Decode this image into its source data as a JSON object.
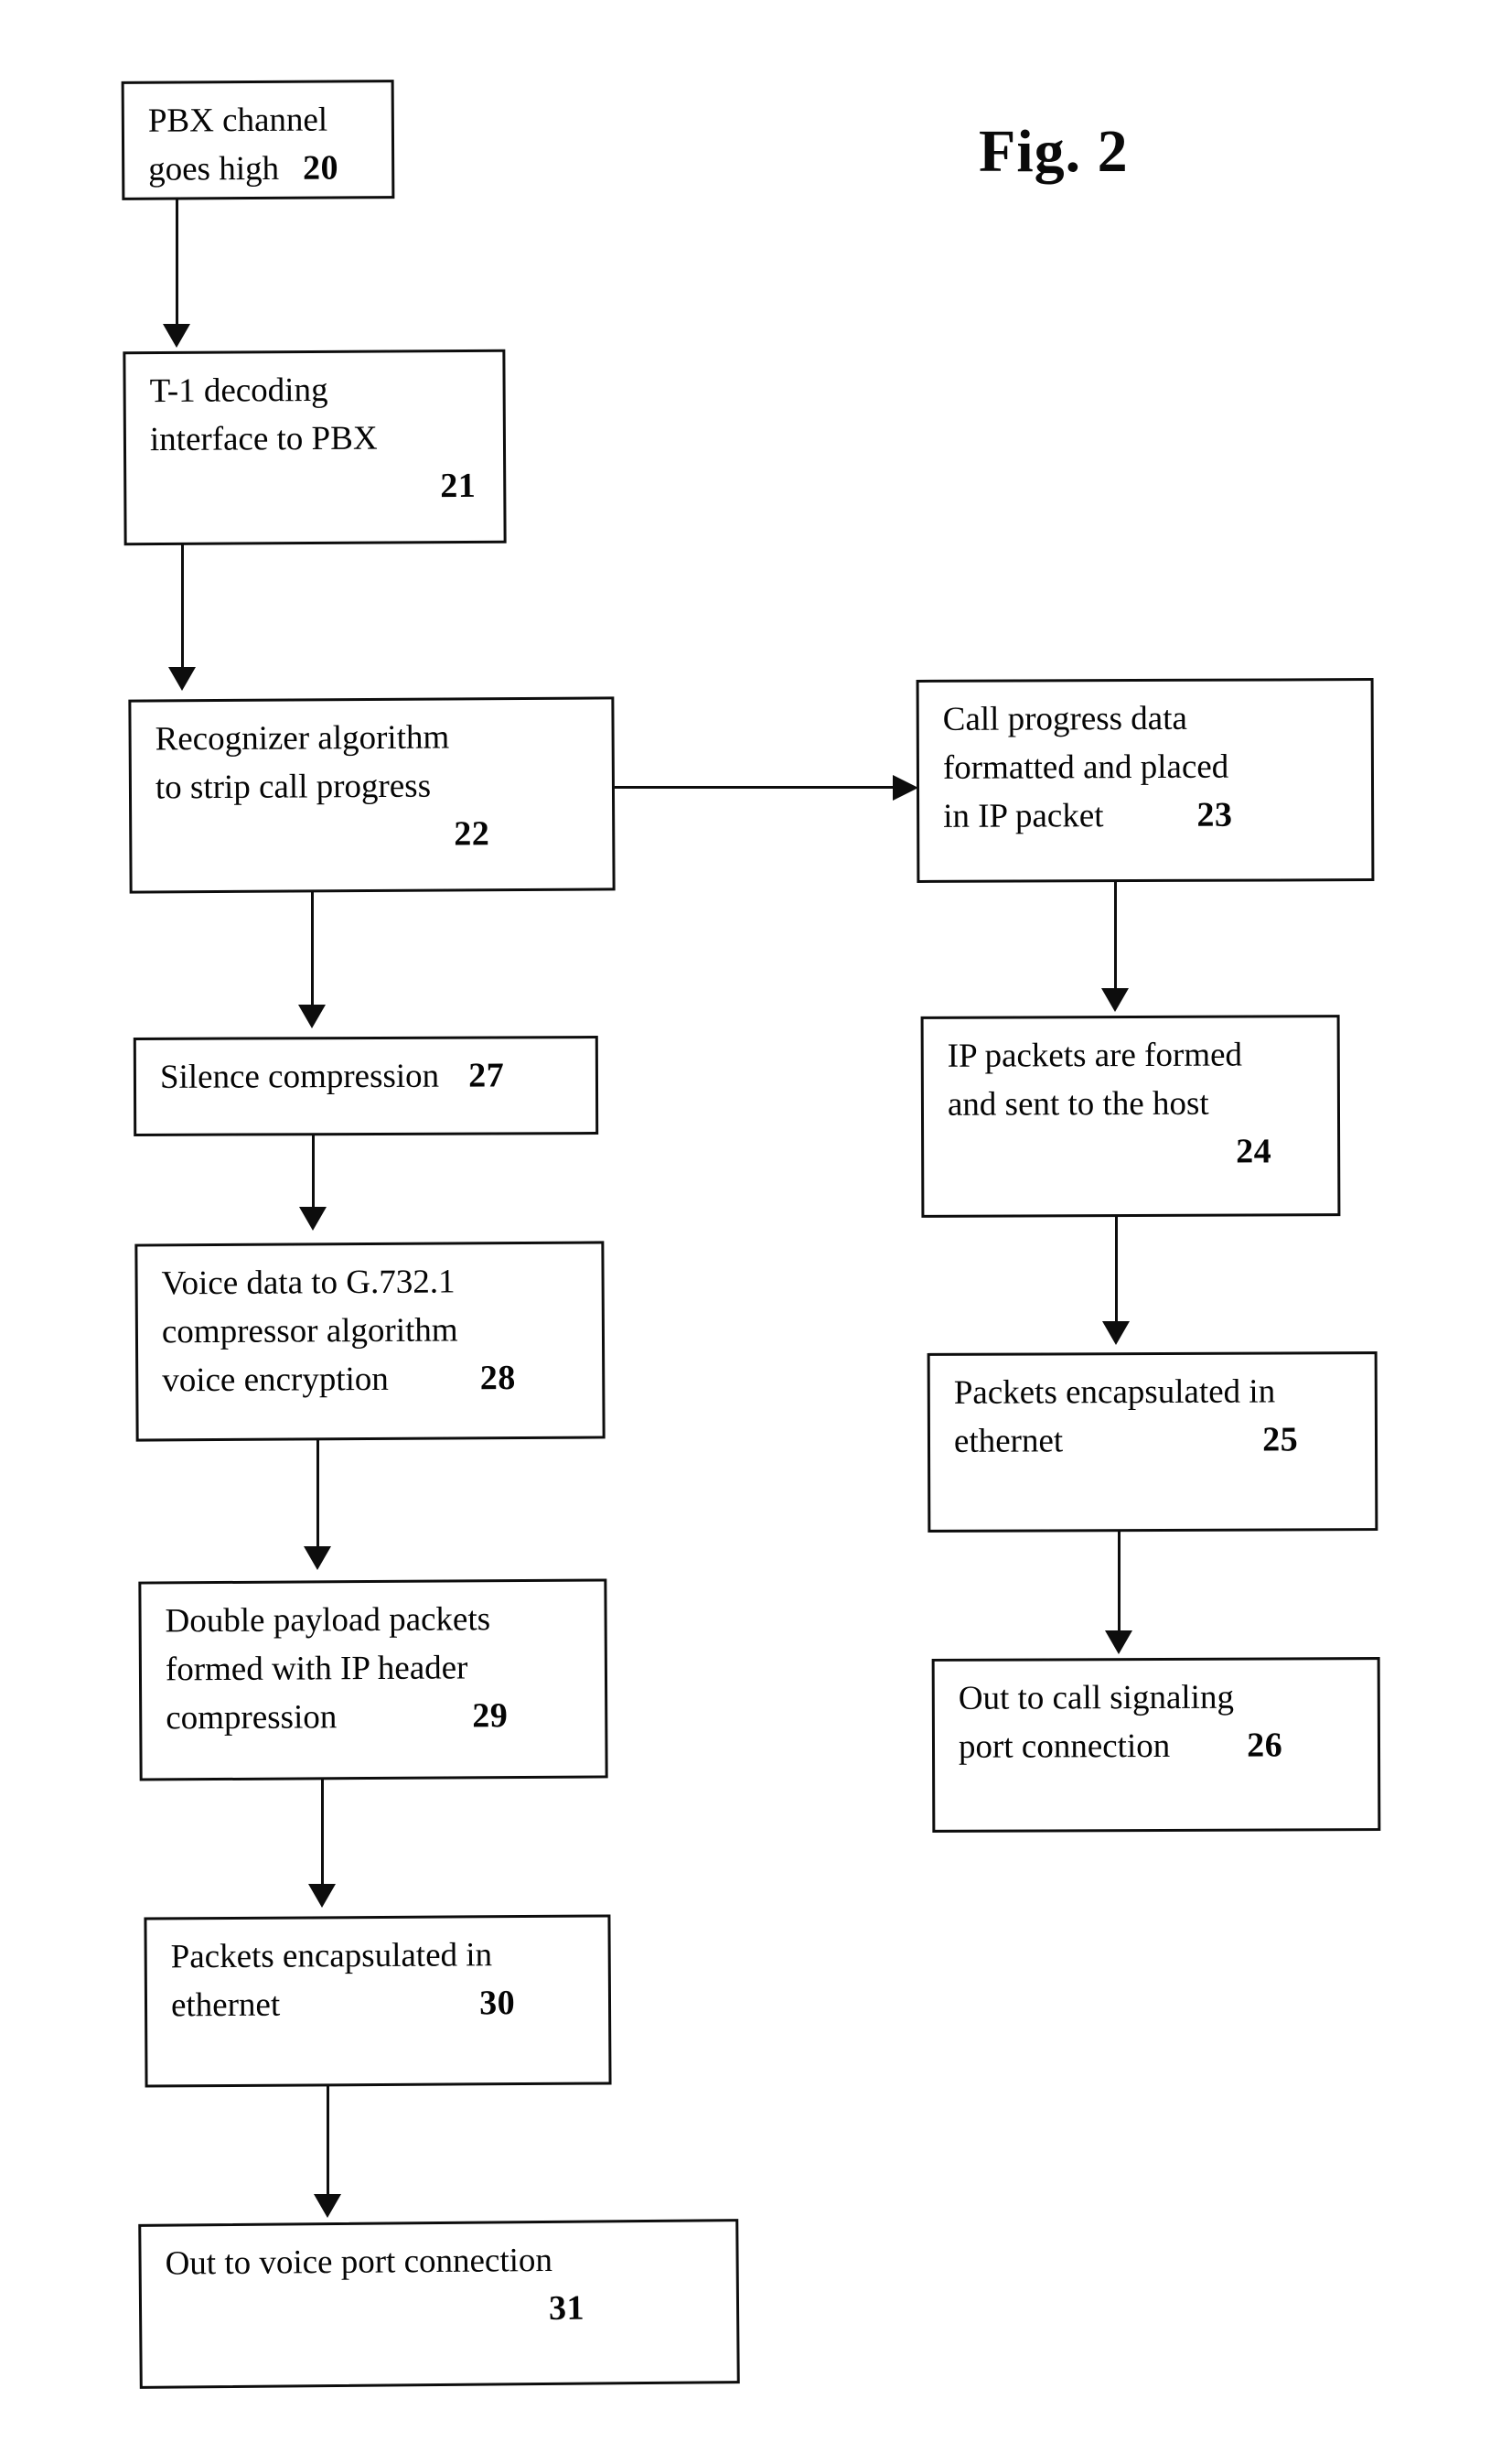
{
  "figure": {
    "title": "Fig. 2",
    "kind": "patent-flowchart"
  },
  "nodes": {
    "n20": {
      "ref": "20",
      "lines": [
        "PBX channel",
        "goes high"
      ]
    },
    "n21": {
      "ref": "21",
      "lines": [
        "T-1 decoding",
        "interface to PBX"
      ]
    },
    "n22": {
      "ref": "22",
      "lines": [
        "Recognizer algorithm",
        "to strip call progress"
      ]
    },
    "n23": {
      "ref": "23",
      "lines": [
        "Call progress data",
        "formatted and placed",
        "in IP packet"
      ]
    },
    "n24": {
      "ref": "24",
      "lines": [
        "IP packets are formed",
        "and sent to the host"
      ]
    },
    "n25": {
      "ref": "25",
      "lines": [
        "Packets encapsulated in",
        "ethernet"
      ]
    },
    "n26": {
      "ref": "26",
      "lines": [
        "Out to call signaling",
        "port connection"
      ]
    },
    "n27": {
      "ref": "27",
      "lines": [
        "Silence compression"
      ]
    },
    "n28": {
      "ref": "28",
      "lines": [
        "Voice data to G.732.1",
        "compressor algorithm",
        "voice encryption"
      ]
    },
    "n29": {
      "ref": "29",
      "lines": [
        "Double payload packets",
        "formed with IP header",
        "compression"
      ]
    },
    "n30": {
      "ref": "30",
      "lines": [
        "Packets encapsulated in",
        "ethernet"
      ]
    },
    "n31": {
      "ref": "31",
      "lines": [
        "Out to voice port connection"
      ]
    }
  },
  "flow": {
    "edges": [
      {
        "from": "20",
        "to": "21",
        "direction": "down"
      },
      {
        "from": "21",
        "to": "22",
        "direction": "down"
      },
      {
        "from": "22",
        "to": "23",
        "direction": "right"
      },
      {
        "from": "22",
        "to": "27",
        "direction": "down"
      },
      {
        "from": "23",
        "to": "24",
        "direction": "down"
      },
      {
        "from": "24",
        "to": "25",
        "direction": "down"
      },
      {
        "from": "25",
        "to": "26",
        "direction": "down"
      },
      {
        "from": "27",
        "to": "28",
        "direction": "down"
      },
      {
        "from": "28",
        "to": "29",
        "direction": "down"
      },
      {
        "from": "29",
        "to": "30",
        "direction": "down"
      },
      {
        "from": "30",
        "to": "31",
        "direction": "down"
      }
    ]
  },
  "colors": {
    "ink": "#0d0d0d",
    "paper": "#ffffff"
  }
}
